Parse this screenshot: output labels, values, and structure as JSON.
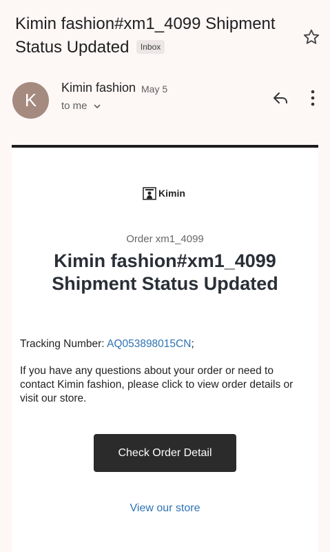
{
  "header": {
    "subject": "Kimin fashion#xm1_4099 Shipment Status Updated",
    "label": "Inbox",
    "star_icon": "star-outline-icon"
  },
  "sender": {
    "avatar_letter": "K",
    "avatar_color": "#a58a80",
    "name": "Kimin fashion",
    "date": "May 5",
    "recipient": "to me",
    "reply_icon": "reply-icon",
    "more_icon": "more-vertical-icon"
  },
  "email": {
    "logo_text": "Kimin",
    "order_label": "Order xm1_4099",
    "headline": "Kimin fashion#xm1_4099 Shipment Status Updated",
    "tracking_label": "Tracking Number: ",
    "tracking_number": "AQ053898015CN",
    "tracking_suffix": ";",
    "help_text": "If you have any questions about your order or need to contact Kimin fashion, please click to view order details or visit our store.",
    "cta_label": "Check Order Detail",
    "store_link": "View our store",
    "link_color": "#2d73b5",
    "button_color": "#2b2b2b"
  }
}
